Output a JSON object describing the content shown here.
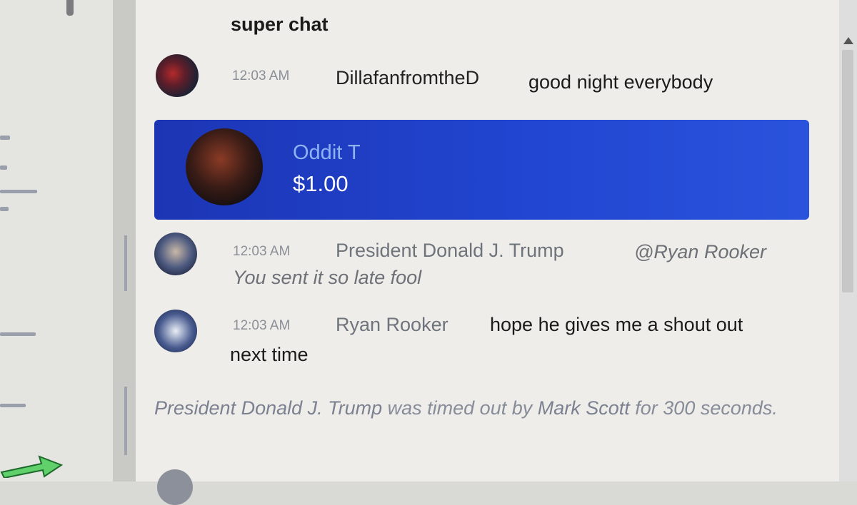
{
  "messages": [
    {
      "author": "",
      "text": "super chat"
    },
    {
      "time": "12:03 AM",
      "author": "DillafanfromtheD",
      "text": "good night everybody"
    },
    {
      "time": "12:03 AM",
      "author": "President Donald J. Trump",
      "text_line1": "@Ryan Rooker",
      "text_line2": "You sent it so late fool"
    },
    {
      "time": "12:03 AM",
      "author": "Ryan Rooker",
      "text_line1": "hope he gives me a shout out",
      "text_line2": "next time"
    }
  ],
  "superchat": {
    "name": "Oddit T",
    "amount": "$1.00",
    "color": "#2145d0"
  },
  "system_message": {
    "subject": "President Donald J. Trump",
    "action": " was timed out by ",
    "moderator": "Mark Scott",
    "tail": " for 300 seconds."
  },
  "avatars": {
    "dillafan": "dillafan-avatar",
    "oddit": "oddit-avatar",
    "trump": "trump-avatar",
    "rooker": "rooker-avatar"
  }
}
